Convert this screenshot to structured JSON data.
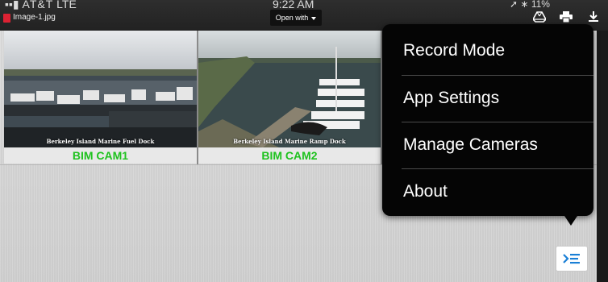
{
  "status_bar": {
    "carrier": "AT&T",
    "network": "LTE",
    "time": "9:22 AM",
    "battery": "11%"
  },
  "viewer": {
    "file_name": "Image-1.jpg",
    "open_with_label": "Open with"
  },
  "cameras": [
    {
      "label": "BIM CAM1",
      "caption": "Berkeley Island Marine Fuel Dock"
    },
    {
      "label": "BIM CAM2",
      "caption": "Berkeley Island Marine Ramp Dock"
    }
  ],
  "menu": {
    "items": [
      {
        "label": "Record Mode"
      },
      {
        "label": "App Settings"
      },
      {
        "label": "Manage Cameras"
      },
      {
        "label": "About"
      }
    ]
  },
  "colors": {
    "camera_label": "#1ec21e",
    "menu_bg": "#050505",
    "menu_button_icon": "#1a7fd6"
  },
  "icons": [
    "drive-icon",
    "print-icon",
    "download-icon",
    "menu-toggle-icon"
  ]
}
